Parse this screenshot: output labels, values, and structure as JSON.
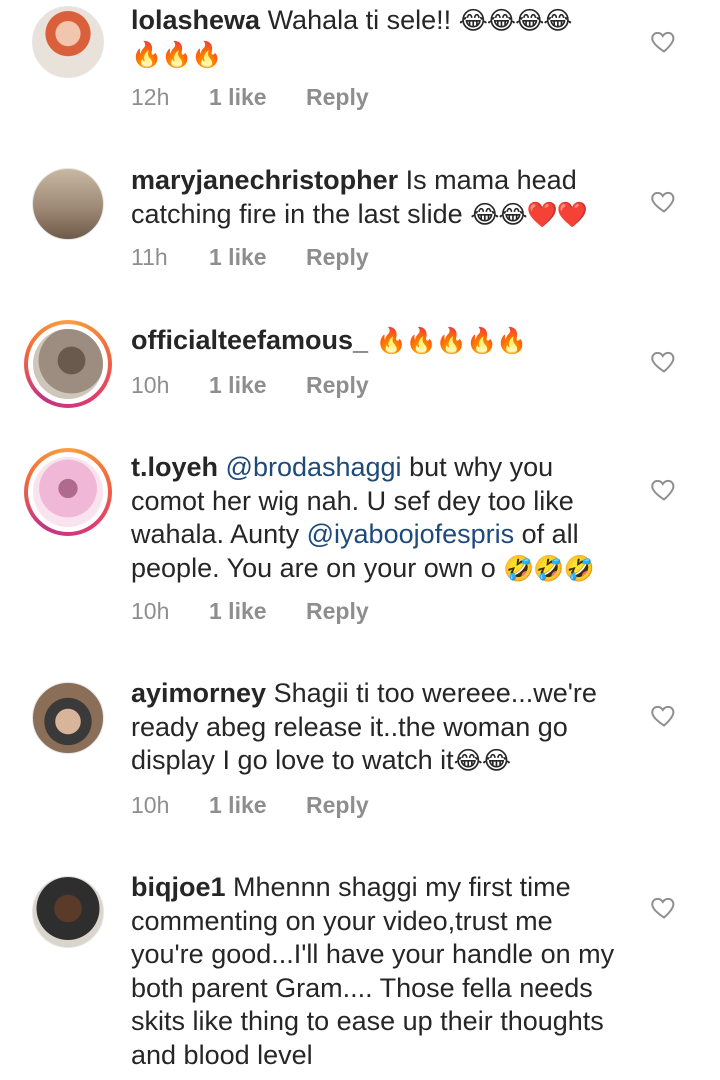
{
  "comments": [
    {
      "username": "lolashewa",
      "pre": "Wahala ti sele!! ",
      "emoji_a": "😂😂😂😂",
      "mid": "",
      "mention1": "",
      "after1": "",
      "mention2": "",
      "after2": "",
      "emoji_b": "🔥🔥🔥",
      "time": "12h",
      "likes": "1 like",
      "reply": "Reply",
      "has_story_ring": false
    },
    {
      "username": "maryjanechristopher",
      "pre": "Is mama head catching fire in the last slide ",
      "emoji_a": "😂😂❤️❤️",
      "mid": "",
      "mention1": "",
      "after1": "",
      "mention2": "",
      "after2": "",
      "emoji_b": "",
      "time": "11h",
      "likes": "1 like",
      "reply": "Reply",
      "has_story_ring": false
    },
    {
      "username": "officialteefamous_",
      "pre": "",
      "emoji_a": "🔥🔥🔥🔥🔥",
      "mid": "",
      "mention1": "",
      "after1": "",
      "mention2": "",
      "after2": "",
      "emoji_b": "",
      "time": "10h",
      "likes": "1 like",
      "reply": "Reply",
      "has_story_ring": true
    },
    {
      "username": "t.loyeh",
      "pre": "",
      "emoji_a": "",
      "mid": "",
      "mention1": "@brodashaggi",
      "after1": " but why you comot her wig nah. U sef dey too like wahala. Aunty ",
      "mention2": "@iyaboojofespris",
      "after2": " of all people. You are on your own o ",
      "emoji_b": "🤣🤣🤣",
      "time": "10h",
      "likes": "1 like",
      "reply": "Reply",
      "has_story_ring": true
    },
    {
      "username": "ayimorney",
      "pre": "Shagii ti too wereee...we're ready abeg release it..the woman go display I go love to watch it",
      "emoji_a": "😂😂",
      "mid": "",
      "mention1": "",
      "after1": "",
      "mention2": "",
      "after2": "",
      "emoji_b": "",
      "time": "10h",
      "likes": "1 like",
      "reply": "Reply",
      "has_story_ring": false
    },
    {
      "username": "biqjoe1",
      "pre": "Mhennn shaggi my first time commenting on your video,trust me you're good...I'll have your handle on my both parent Gram.... Those fella needs skits like thing to ease up their thoughts and blood level",
      "emoji_a": "",
      "mid": "",
      "mention1": "",
      "after1": "",
      "mention2": "",
      "after2": "",
      "emoji_b": "",
      "time": "",
      "likes": "",
      "reply": "",
      "has_story_ring": false
    }
  ],
  "icons": {
    "like": "heart-outline-icon"
  },
  "colors": {
    "mention": "#1e4a7a",
    "meta": "#8e8e8e",
    "ring_start": "#f9a23b",
    "ring_end": "#c13584"
  }
}
